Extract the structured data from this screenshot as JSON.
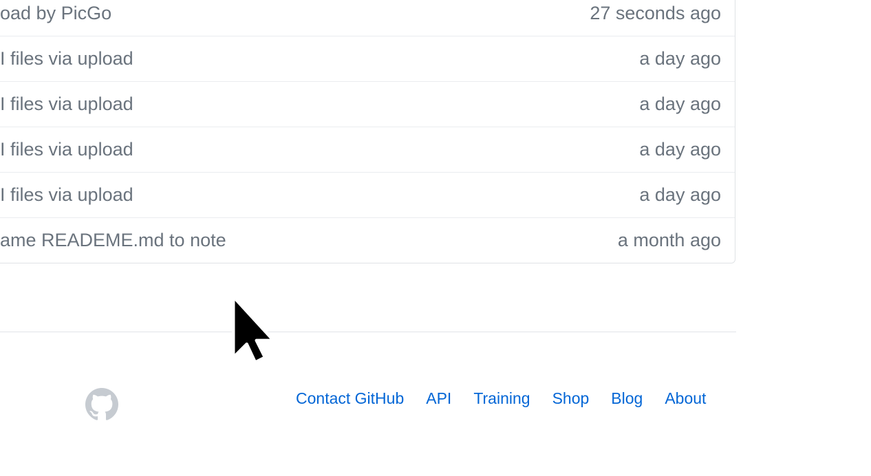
{
  "commits": [
    {
      "message": "oad by PicGo",
      "age": "27 seconds ago"
    },
    {
      "message": "I files via upload",
      "age": "a day ago"
    },
    {
      "message": "I files via upload",
      "age": "a day ago"
    },
    {
      "message": "I files via upload",
      "age": "a day ago"
    },
    {
      "message": "I files via upload",
      "age": "a day ago"
    },
    {
      "message": "ame READEME.md to note",
      "age": "a month ago"
    }
  ],
  "footer": {
    "logo_icon": "github-octocat-icon",
    "links": [
      "Contact GitHub",
      "API",
      "Training",
      "Shop",
      "Blog",
      "About"
    ]
  },
  "colors": {
    "text_muted": "#6a737d",
    "link": "#0366d6",
    "border": "#dfe2e5",
    "logo": "#c6cbd1"
  }
}
